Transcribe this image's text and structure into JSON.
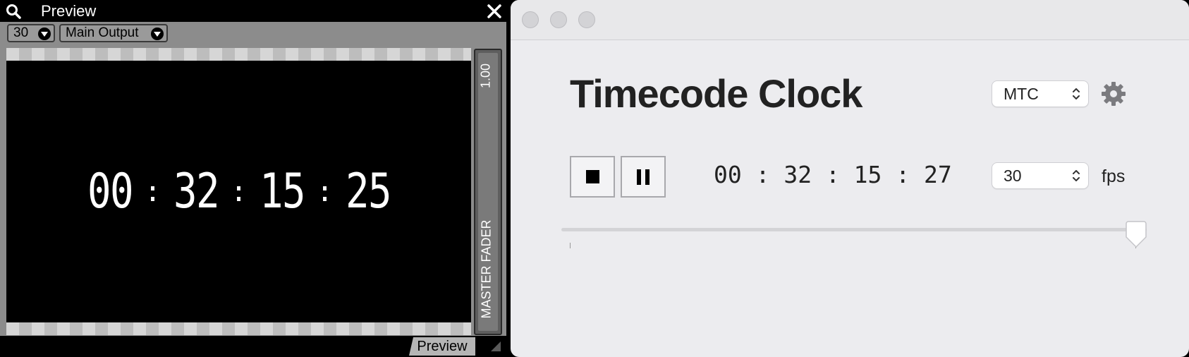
{
  "preview_panel": {
    "title": "Preview",
    "fps_dropdown": "30",
    "output_dropdown": "Main Output",
    "screen_timecode": {
      "hours": "00",
      "minutes": "32",
      "seconds": "15",
      "frames": "25"
    },
    "fader_value": "1.00",
    "fader_label": "MASTER FADER",
    "tab_label": "Preview",
    "icons": [
      "search-icon",
      "close-icon",
      "dropdown-triangle-icon",
      "resize-corner-icon"
    ]
  },
  "timecode_window": {
    "title": "Timecode Clock",
    "mode_select": "MTC",
    "timecode": "00 : 32 : 15 : 27",
    "rate_select": "30",
    "fps_label": "fps",
    "slider_value": 1.0,
    "icons": [
      "gear-icon",
      "stop-icon",
      "pause-icon",
      "chevron-updown-icon"
    ]
  },
  "colors": {
    "panel_gray": "#8c8c8c",
    "window_bg": "#ececef",
    "text_dark": "#222222"
  }
}
